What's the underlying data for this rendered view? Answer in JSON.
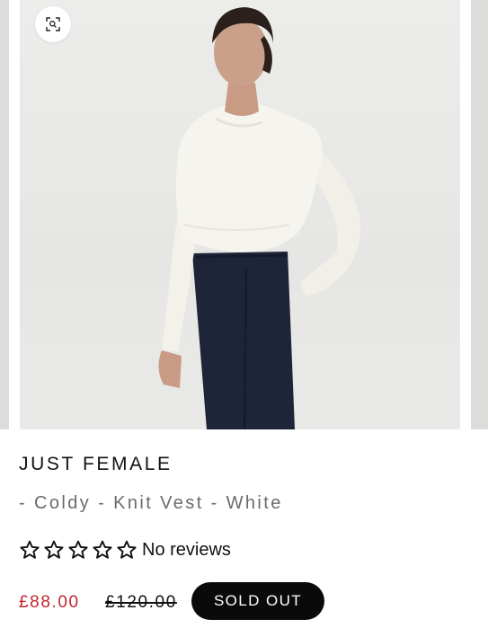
{
  "product": {
    "vendor": "JUST FEMALE",
    "title": "- Coldy - Knit Vest - White",
    "rating": {
      "value": 0,
      "max": 5,
      "label": "No reviews"
    },
    "price": {
      "sale": "£88.00",
      "compare_at": "£120.00"
    },
    "button_label": "SOLD OUT"
  },
  "gallery": {
    "zoom_icon": "zoom-icon",
    "image_subject": "model-wearing-white-knit-vest"
  },
  "colors": {
    "sale_price": "#c0272d",
    "button_bg": "#0a0a0a",
    "button_text": "#ffffff",
    "subtitle": "#6b6b6b"
  }
}
